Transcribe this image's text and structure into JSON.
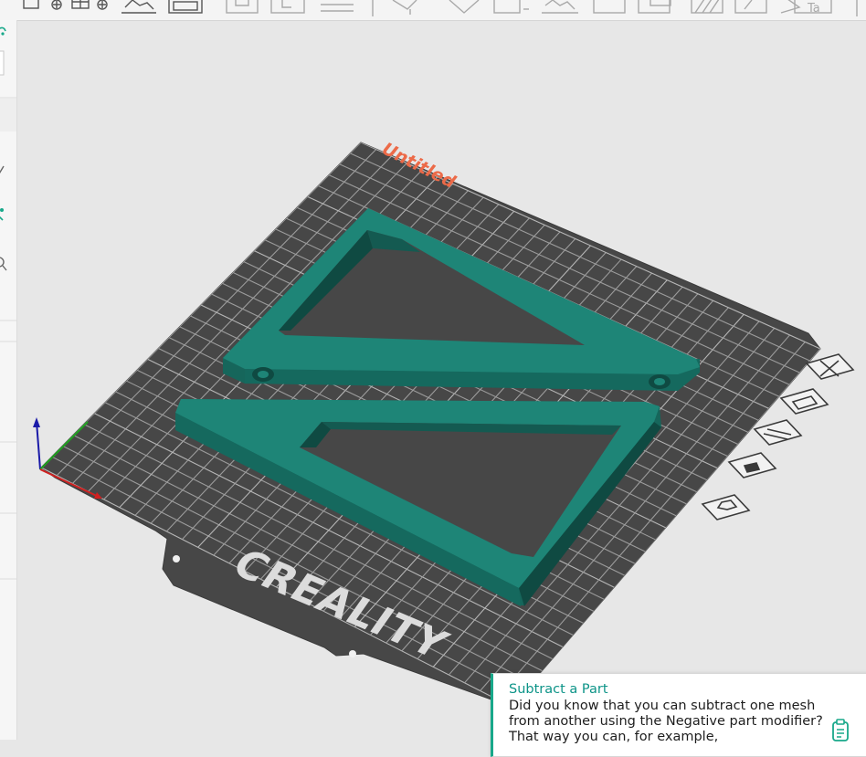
{
  "plate": {
    "name": "Untitled",
    "brand": "CREALITY",
    "colors": {
      "plate": "#474747",
      "grid": "#9c9c9c",
      "label": "#ec6a48",
      "model": "#1e8577",
      "model_side": "#16665b",
      "model_dark": "#0f4a42"
    }
  },
  "toolbar": {
    "icons": [
      "add-icon",
      "add-plate-icon",
      "orient-icon",
      "arrange-icon",
      "split-icon",
      "cut-icon",
      "layer-icon",
      "support-paint-icon",
      "seam-paint-icon",
      "measure-icon",
      "text-icon"
    ]
  },
  "sidebar": {
    "icons": [
      "wifi-icon",
      "input-box",
      "edit-icon",
      "settings-icon",
      "search-icon"
    ]
  },
  "plate_toolbar": {
    "buttons": [
      "close-plate",
      "auto-orient",
      "arrange-plate",
      "lock-plate",
      "plate-settings"
    ]
  },
  "tip": {
    "title": "Subtract a Part",
    "text": "Did you know that you can subtract one mesh from another using the Negative part modifier? That way you can, for example,"
  }
}
